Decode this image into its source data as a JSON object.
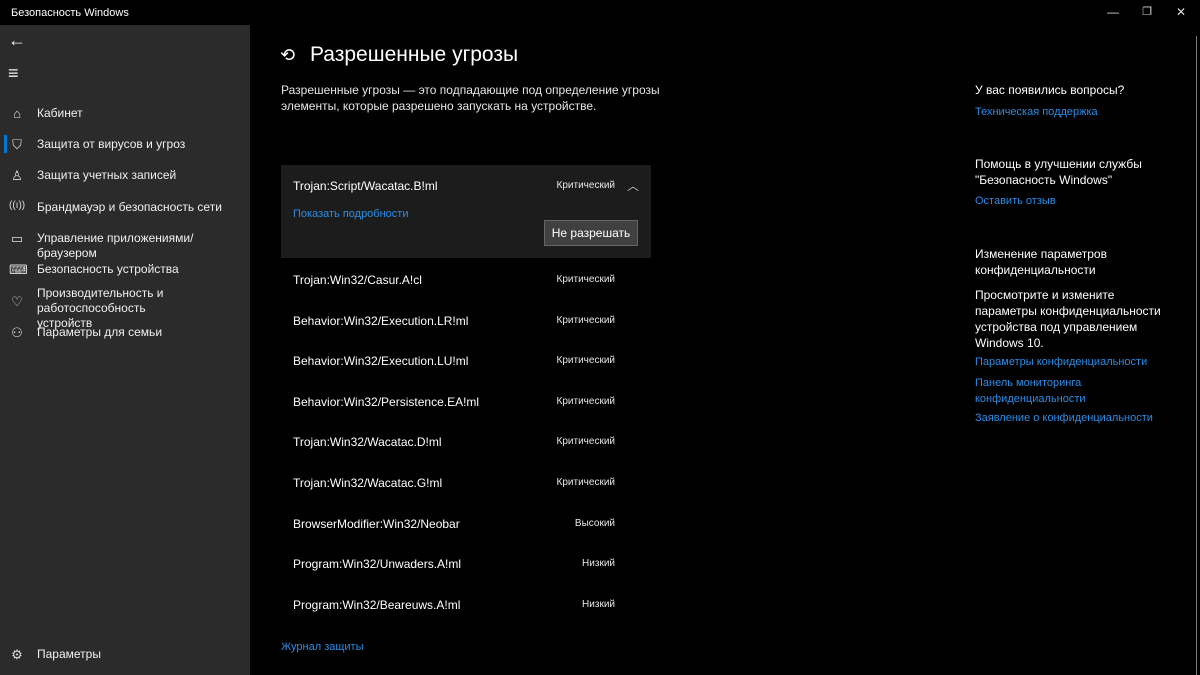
{
  "window": {
    "title": "Безопасность Windows",
    "minimize": "—",
    "maximize": "❐",
    "close": "✕"
  },
  "sidebar": {
    "back": "←",
    "menu": "≡",
    "items": [
      {
        "label": "Кабинет",
        "icon": "home-icon"
      },
      {
        "label": "Защита от вирусов и угроз",
        "icon": "shield-icon"
      },
      {
        "label": "Защита учетных записей",
        "icon": "person-icon"
      },
      {
        "label": "Брандмауэр и безопасность сети",
        "icon": "wireless-icon"
      },
      {
        "label": "Управление приложениями/браузером",
        "icon": "browser-icon"
      },
      {
        "label": "Безопасность устройства",
        "icon": "laptop-icon"
      },
      {
        "label": "Производительность и работоспособность устройств",
        "icon": "heart-icon"
      },
      {
        "label": "Параметры для семьи",
        "icon": "family-icon"
      }
    ],
    "settings": "Параметры"
  },
  "main": {
    "title": "Разрешенные угрозы",
    "description": "Разрешенные угрозы — это подпадающие под определение угрозы элементы, которые разрешено запускать на устройстве.",
    "expanded": {
      "name": "Trojan:Script/Wacatac.B!ml",
      "severity": "Критический",
      "details_link": "Показать подробности",
      "button": "Не разрешать"
    },
    "threats": [
      {
        "name": "Trojan:Win32/Casur.A!cl",
        "severity": "Критический"
      },
      {
        "name": "Behavior:Win32/Execution.LR!ml",
        "severity": "Критический"
      },
      {
        "name": "Behavior:Win32/Execution.LU!ml",
        "severity": "Критический"
      },
      {
        "name": "Behavior:Win32/Persistence.EA!ml",
        "severity": "Критический"
      },
      {
        "name": "Trojan:Win32/Wacatac.D!ml",
        "severity": "Критический"
      },
      {
        "name": "Trojan:Win32/Wacatac.G!ml",
        "severity": "Критический"
      },
      {
        "name": "BrowserModifier:Win32/Neobar",
        "severity": "Высокий"
      },
      {
        "name": "Program:Win32/Unwaders.A!ml",
        "severity": "Низкий"
      },
      {
        "name": "Program:Win32/Beareuws.A!ml",
        "severity": "Низкий"
      }
    ],
    "history_link": "Журнал защиты"
  },
  "right": {
    "q_title": "У вас появились вопросы?",
    "support": "Техническая поддержка",
    "help_title": "Помощь в улучшении службы \"Безопасность Windows\"",
    "feedback": "Оставить отзыв",
    "privacy_title": "Изменение параметров конфиденциальности",
    "privacy_text": "Просмотрите и измените параметры конфиденциальности устройства под управлением Windows 10.",
    "privacy_settings": "Параметры конфиденциальности",
    "privacy_dashboard": "Панель мониторинга конфиденциальности",
    "privacy_statement": "Заявление о конфиденциальности"
  }
}
